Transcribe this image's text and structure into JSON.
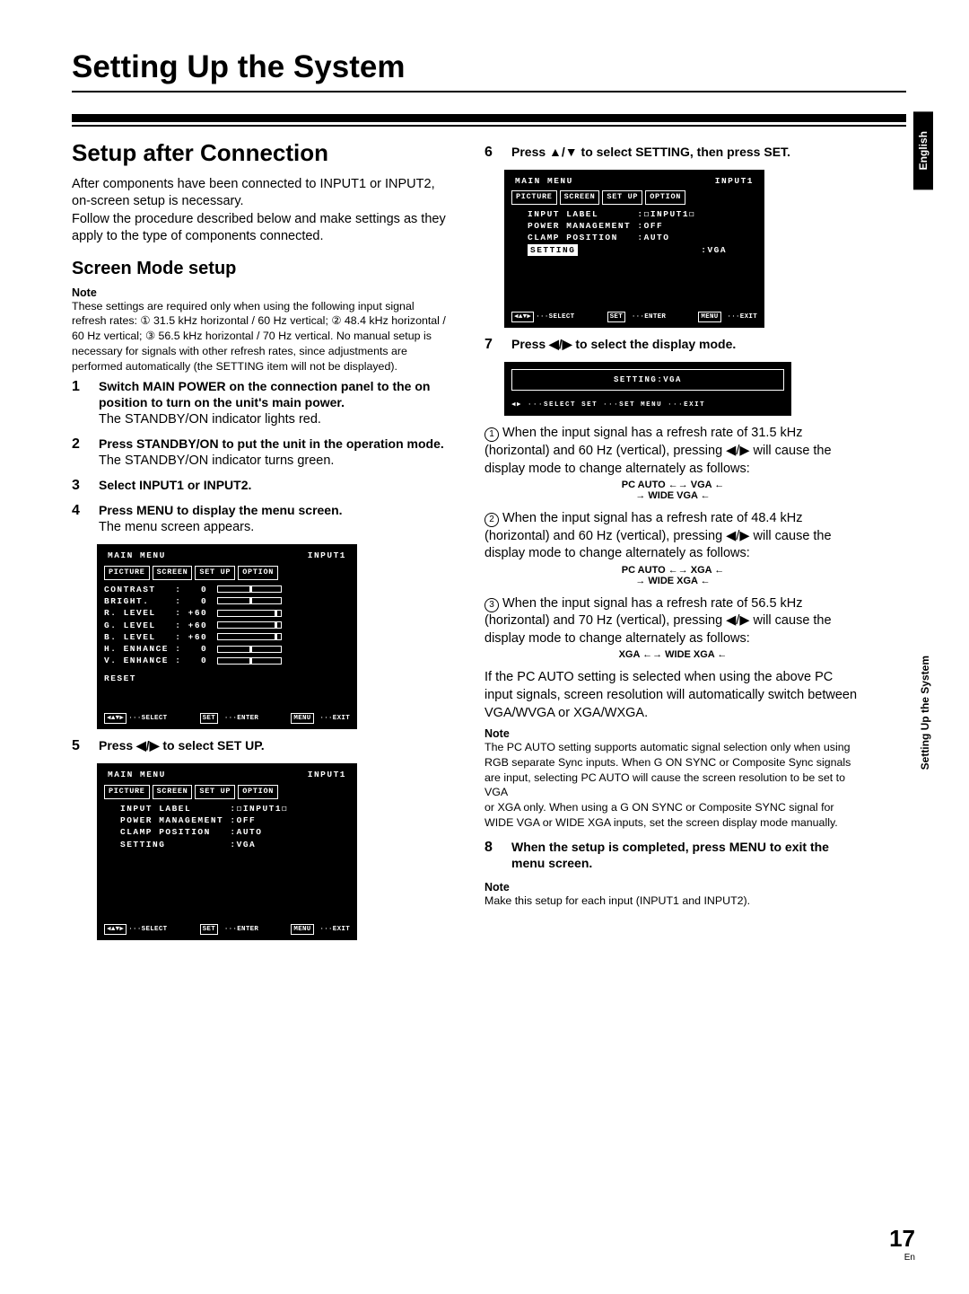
{
  "page_title": "Setting Up the System",
  "h2a": "Setup after Connection",
  "intro": "After components have been connected to INPUT1 or INPUT2, on-screen setup is necessary.\nFollow the procedure described below and make settings as they apply to the type of components connected.",
  "h3a": "Screen Mode setup",
  "note_hd": "Note",
  "note1": "These settings are required only when using the following input signal refresh rates: ① 31.5 kHz horizontal / 60 Hz vertical; ② 48.4 kHz horizontal / 60 Hz vertical; ③ 56.5 kHz horizontal / 70 Hz vertical. No manual setup is necessary for signals with other refresh rates, since adjustments are performed automatically (the SETTING item will not be displayed).",
  "steps_left": [
    {
      "n": "1",
      "b": "Switch MAIN POWER on the connection panel to the on position to turn on the unit's main power.",
      "t": "The STANDBY/ON indicator lights red."
    },
    {
      "n": "2",
      "b": "Press STANDBY/ON to put the unit in the operation mode.",
      "t": "The STANDBY/ON indicator turns green."
    },
    {
      "n": "3",
      "b": "Select INPUT1 or INPUT2.",
      "t": ""
    },
    {
      "n": "4",
      "b": "Press MENU to display the menu screen.",
      "t": "The menu screen appears."
    }
  ],
  "step5": {
    "n": "5",
    "b": "Press ◀/▶ to select SET UP."
  },
  "osd_main": {
    "title_l": "MAIN MENU",
    "title_r": "INPUT1",
    "tabs": [
      "PICTURE",
      "SCREEN",
      "SET UP",
      "OPTION"
    ],
    "rows": [
      {
        "l": "CONTRAST",
        "v": "0",
        "p": 50
      },
      {
        "l": "BRIGHT.",
        "v": "0",
        "p": 50
      },
      {
        "l": "R. LEVEL",
        "v": "+60",
        "p": 90
      },
      {
        "l": "G. LEVEL",
        "v": "+60",
        "p": 90
      },
      {
        "l": "B. LEVEL",
        "v": "+60",
        "p": 90
      },
      {
        "l": "H. ENHANCE",
        "v": "0",
        "p": 50
      },
      {
        "l": "V. ENHANCE",
        "v": "0",
        "p": 50
      }
    ],
    "reset": "RESET",
    "foot_sel": "SELECT",
    "foot_ent": "ENTER",
    "foot_exit": "EXIT",
    "foot_set": "SET",
    "foot_menu": "MENU"
  },
  "osd_setup": {
    "rows": [
      {
        "l": "INPUT LABEL",
        "v": ":◻INPUT1◻"
      },
      {
        "l": "POWER MANAGEMENT",
        "v": ":OFF"
      },
      {
        "l": "CLAMP POSITION",
        "v": ":AUTO"
      },
      {
        "l": "SETTING",
        "v": ":VGA"
      }
    ]
  },
  "step6": {
    "n": "6",
    "b": "Press ▲/▼ to select SETTING, then press SET."
  },
  "step7": {
    "n": "7",
    "b": "Press ◀/▶ to select the display mode."
  },
  "setting_small": "SETTING:VGA",
  "cyc1_pre": "When the input signal has a refresh rate of 31.5 kHz (horizontal) and 60 Hz (vertical), pressing ◀/▶ will cause the display mode to change alternately as follows:",
  "cyc1": "PC AUTO ←→ VGA ←\n→ WIDE VGA ←",
  "cyc2_pre": "When the input signal has a refresh rate of 48.4 kHz (horizontal) and 60 Hz (vertical), pressing ◀/▶ will cause the display mode to change alternately as follows:",
  "cyc2": "PC AUTO ←→ XGA ←\n→ WIDE XGA ←",
  "cyc3_pre": "When the input signal has a refresh rate of 56.5 kHz (horizontal) and 70 Hz (vertical), pressing ◀/▶ will cause the display mode to change alternately as follows:",
  "cyc3": "XGA ←→ WIDE XGA ←",
  "after": "If the PC AUTO setting is selected when using the above PC input signals, screen resolution will automatically switch between VGA/WVGA or XGA/WXGA.",
  "note2": "The PC AUTO setting supports automatic signal selection only when using RGB separate Sync inputs. When G ON SYNC or Composite Sync signals are input, selecting PC AUTO will cause the screen resolution to be set to VGA\nor XGA only. When using a G ON SYNC or Composite SYNC signal for WIDE VGA or WIDE XGA inputs, set the screen display mode manually.",
  "step8": {
    "n": "8",
    "b": "When the setup is completed, press MENU to exit the menu screen."
  },
  "note3": "Make this setup for each input (INPUT1 and INPUT2).",
  "side_en": "English",
  "side_sec": "Setting Up the System",
  "pagenum": "17",
  "pagelang": "En",
  "chart_data": {
    "type": "table",
    "title": "PICTURE menu defaults",
    "categories": [
      "CONTRAST",
      "BRIGHT.",
      "R. LEVEL",
      "G. LEVEL",
      "B. LEVEL",
      "H. ENHANCE",
      "V. ENHANCE"
    ],
    "values": [
      0,
      0,
      60,
      60,
      60,
      0,
      0
    ]
  }
}
